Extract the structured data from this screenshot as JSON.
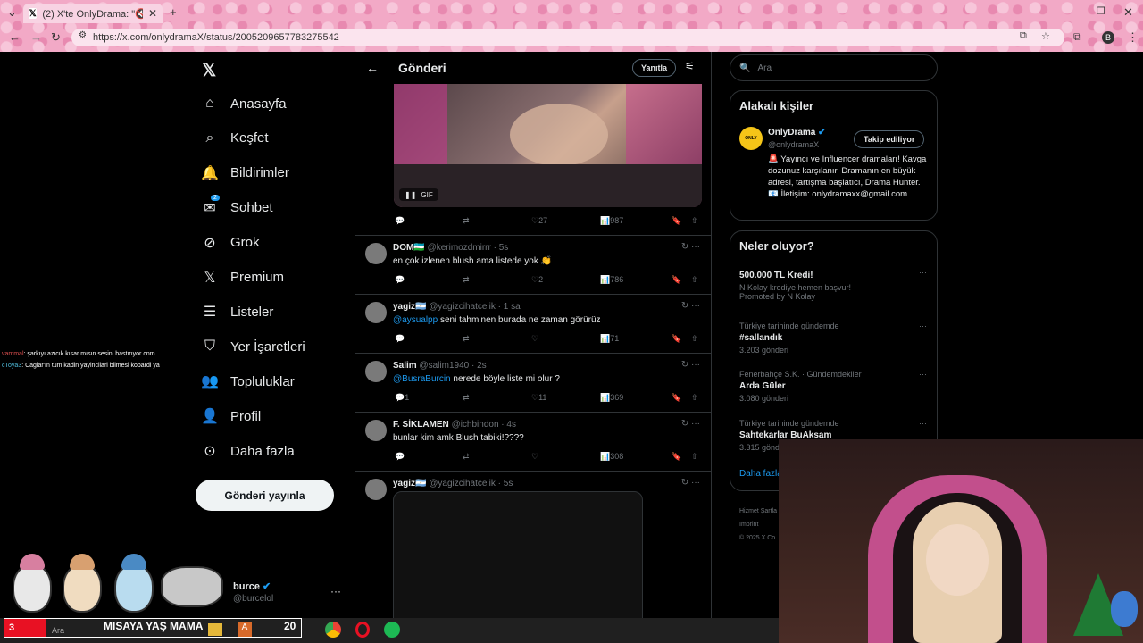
{
  "browser": {
    "tab_title": "(2) X'te OnlyDrama: \"🔇 2025",
    "url": "https://x.com/onlydramaX/status/2005209657783275542"
  },
  "nav": {
    "items": [
      {
        "label": "Anasayfa",
        "icon": "home-icon"
      },
      {
        "label": "Keşfet",
        "icon": "search-icon"
      },
      {
        "label": "Bildirimler",
        "icon": "bell-icon"
      },
      {
        "label": "Sohbet",
        "icon": "mail-icon",
        "badge": "2"
      },
      {
        "label": "Grok",
        "icon": "grok-icon"
      },
      {
        "label": "Premium",
        "icon": "x-icon"
      },
      {
        "label": "Listeler",
        "icon": "list-icon"
      },
      {
        "label": "Yer İşaretleri",
        "icon": "bookmark-icon"
      },
      {
        "label": "Topluluklar",
        "icon": "people-icon"
      },
      {
        "label": "Profil",
        "icon": "person-icon"
      },
      {
        "label": "Daha fazla",
        "icon": "more-icon"
      }
    ],
    "post_button": "Gönderi yayınla",
    "account_name": "burce",
    "account_handle": "@burcelol"
  },
  "header": {
    "title": "Gönderi",
    "reply_button": "Yanıtla"
  },
  "media": {
    "gif_label": "GIF"
  },
  "main_actions": {
    "likes": "27",
    "views": "987"
  },
  "tweets": [
    {
      "name": "DOM🇺🇿",
      "handle": "@kerimozdmirrr · 5s",
      "text": "en çok izlenen blush ama listede yok 👏",
      "mention": "",
      "replies": "",
      "likes": "2",
      "views": "786"
    },
    {
      "name": "yagiz🇦🇷",
      "handle": "@yagizcihatcelik · 1 sa",
      "text": "seni tahminen burada ne zaman görürüz",
      "mention": "@aysualpp",
      "replies": "",
      "likes": "",
      "views": "71"
    },
    {
      "name": "Salim",
      "handle": "@salim1940 · 2s",
      "text": "nerede böyle liste mi olur ?",
      "mention": "@BusraBurcin",
      "replies": "1",
      "likes": "11",
      "views": "369"
    },
    {
      "name": "F. SİKLAMEN",
      "handle": "@ichbindon · 4s",
      "text": "bunlar kim amk Blush tabiki!????",
      "mention": "",
      "replies": "",
      "likes": "",
      "views": "308"
    },
    {
      "name": "yagiz🇦🇷",
      "handle": "@yagizcihatcelik · 5s",
      "text": "",
      "mention": "",
      "replies": "",
      "likes": "",
      "views": ""
    }
  ],
  "search": {
    "placeholder": "Ara"
  },
  "related": {
    "title": "Alakalı kişiler",
    "name": "OnlyDrama",
    "handle": "@onlydramaX",
    "follow_button": "Takip ediliyor",
    "bio": "🚨 Yayıncı ve Influencer dramaları! Kavga dozunuz karşılanır. Dramanın en büyük adresi, tartışma başlatıcı, Drama Hunter. 📧 İletişim: onlydramaxx@gmail.com"
  },
  "trends": {
    "title": "Neler oluyor?",
    "items": [
      {
        "context": "",
        "name": "500.000 TL Kredi!",
        "sub": "N Kolay krediye hemen başvur!",
        "count": "Promoted by N Kolay"
      },
      {
        "context": "Türkiye tarihinde gündemde",
        "name": "#sallandık",
        "sub": "",
        "count": "3.203 gönderi"
      },
      {
        "context": "Fenerbahçe S.K. · Gündemdekiler",
        "name": "Arda Güler",
        "sub": "",
        "count": "3.080 gönderi"
      },
      {
        "context": "Türkiye tarihinde gündemde",
        "name": "Sahtekarlar BuAksam",
        "sub": "",
        "count": "3.315 gönderi"
      }
    ],
    "more": "Daha fazla"
  },
  "footer": {
    "line1": "Hizmet Şartla",
    "line2": "Imprint",
    "line3": "© 2025 X Co"
  },
  "chat": [
    {
      "user": "vammal",
      "text": ": şarkıyı azıcık kısar mısın sesini bastırıyor cnm"
    },
    {
      "user": "cToya3",
      "text": ": Caglar'ın tum kadin yayincilari bilmesi kopardi ya"
    }
  ],
  "taskbar": {
    "counter": "3",
    "search": "Ara",
    "banner": "MISAYA YAŞ MAMA",
    "number": "20"
  },
  "colors": {
    "accent": "#1d9bf0",
    "chrome": "#f2a9c6",
    "banner_red": "#e81123"
  }
}
